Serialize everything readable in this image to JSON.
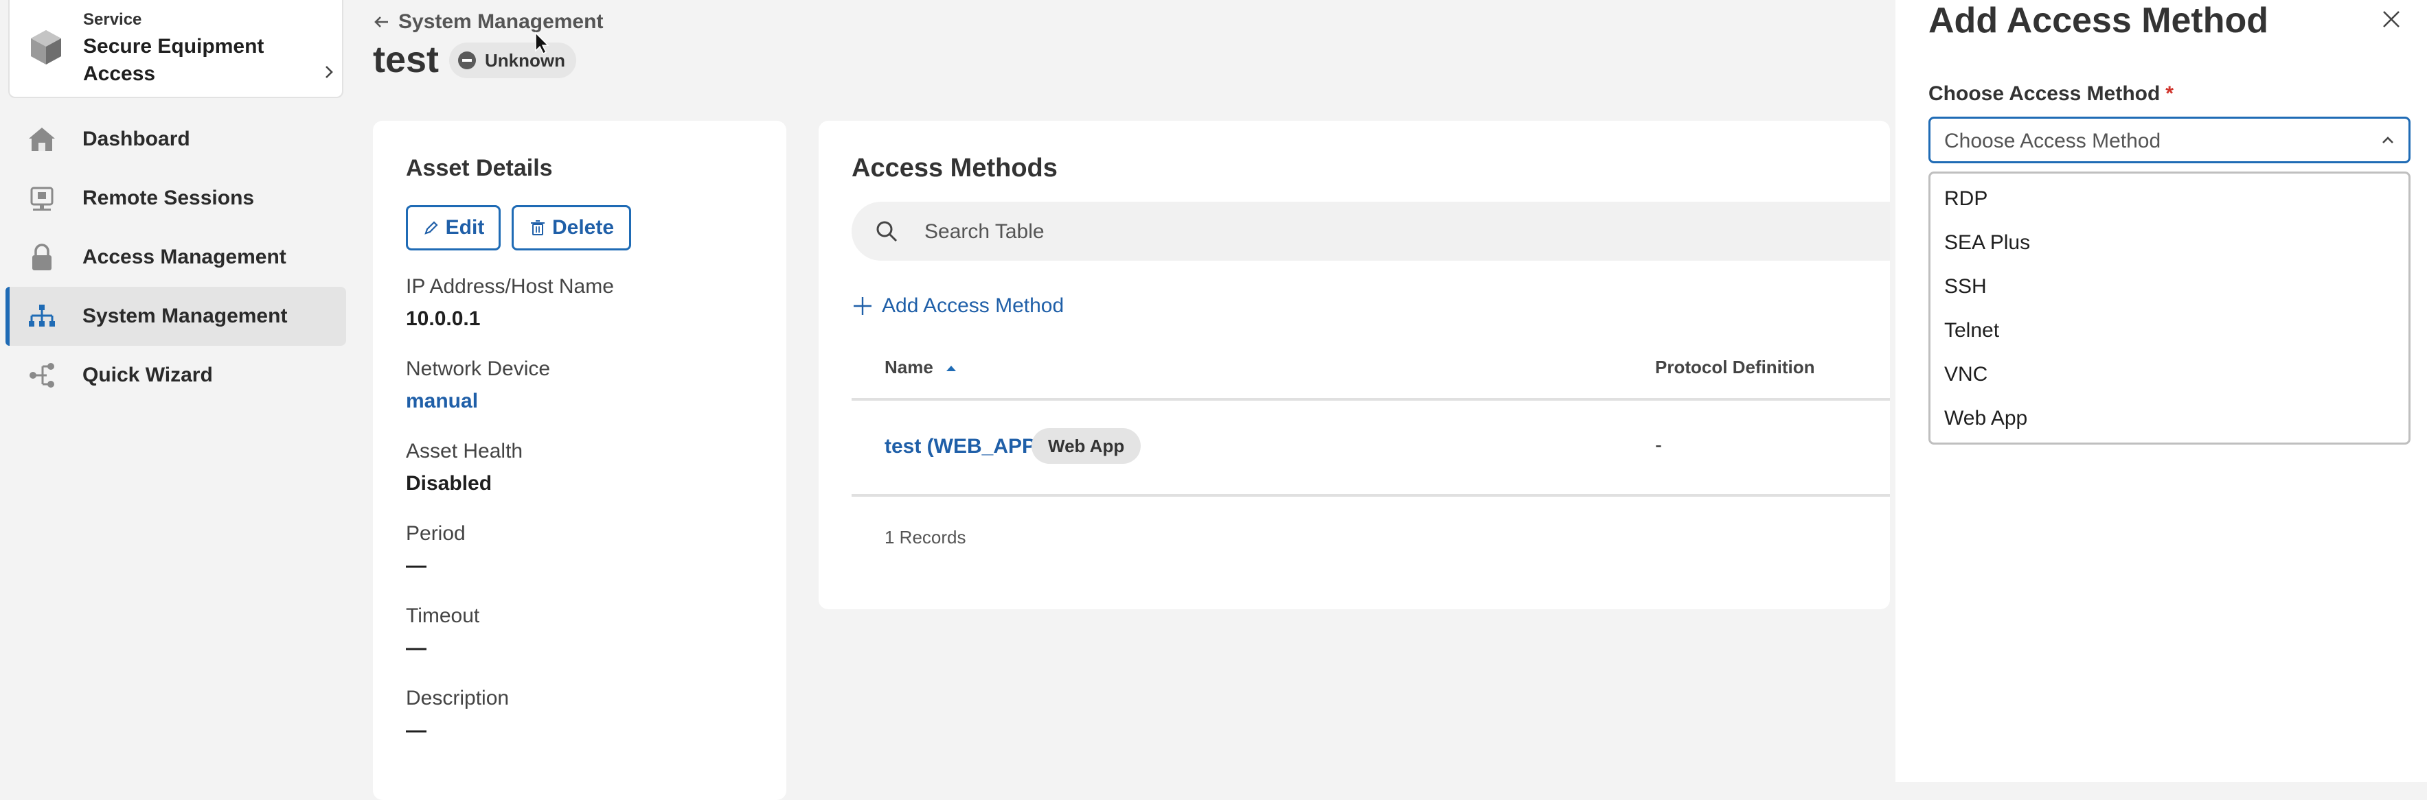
{
  "sidebar": {
    "service_caption": "Service",
    "service_name": "Secure Equipment Access",
    "items": [
      {
        "label": "Dashboard",
        "icon": "home-icon",
        "active": false
      },
      {
        "label": "Remote Sessions",
        "icon": "remote-sessions-icon",
        "active": false
      },
      {
        "label": "Access Management",
        "icon": "lock-icon",
        "active": false
      },
      {
        "label": "System Management",
        "icon": "network-icon",
        "active": true
      },
      {
        "label": "Quick Wizard",
        "icon": "wizard-icon",
        "active": false
      }
    ]
  },
  "header": {
    "breadcrumb": "System Management",
    "title": "test",
    "status": "Unknown"
  },
  "asset": {
    "title": "Asset Details",
    "edit_label": "Edit",
    "delete_label": "Delete",
    "fields": [
      {
        "label": "IP Address/Host Name",
        "value": "10.0.0.1"
      },
      {
        "label": "Network Device",
        "value": "manual"
      },
      {
        "label": "Asset Health",
        "value": "Disabled"
      },
      {
        "label": "Period",
        "value": "—"
      },
      {
        "label": "Timeout",
        "value": "—"
      },
      {
        "label": "Description",
        "value": "—"
      }
    ]
  },
  "methods": {
    "title": "Access Methods",
    "search_placeholder": "Search Table",
    "add_label": "Add Access Method",
    "columns": [
      "Name",
      "Protocol Definition"
    ],
    "rows": [
      {
        "name": "test (WEB_APP)",
        "tag": "Web App",
        "protocol": "-"
      }
    ],
    "records": "1 Records"
  },
  "drawer": {
    "title": "Add Access Method",
    "select_label": "Choose Access Method",
    "required_mark": "*",
    "select_placeholder": "Choose Access Method",
    "options": [
      "RDP",
      "SEA Plus",
      "SSH",
      "Telnet",
      "VNC",
      "Web App"
    ]
  },
  "colors": {
    "accent": "#1f6bb5",
    "link": "#1f5fa8",
    "required": "#d0342c",
    "background": "#f3f3f3"
  }
}
